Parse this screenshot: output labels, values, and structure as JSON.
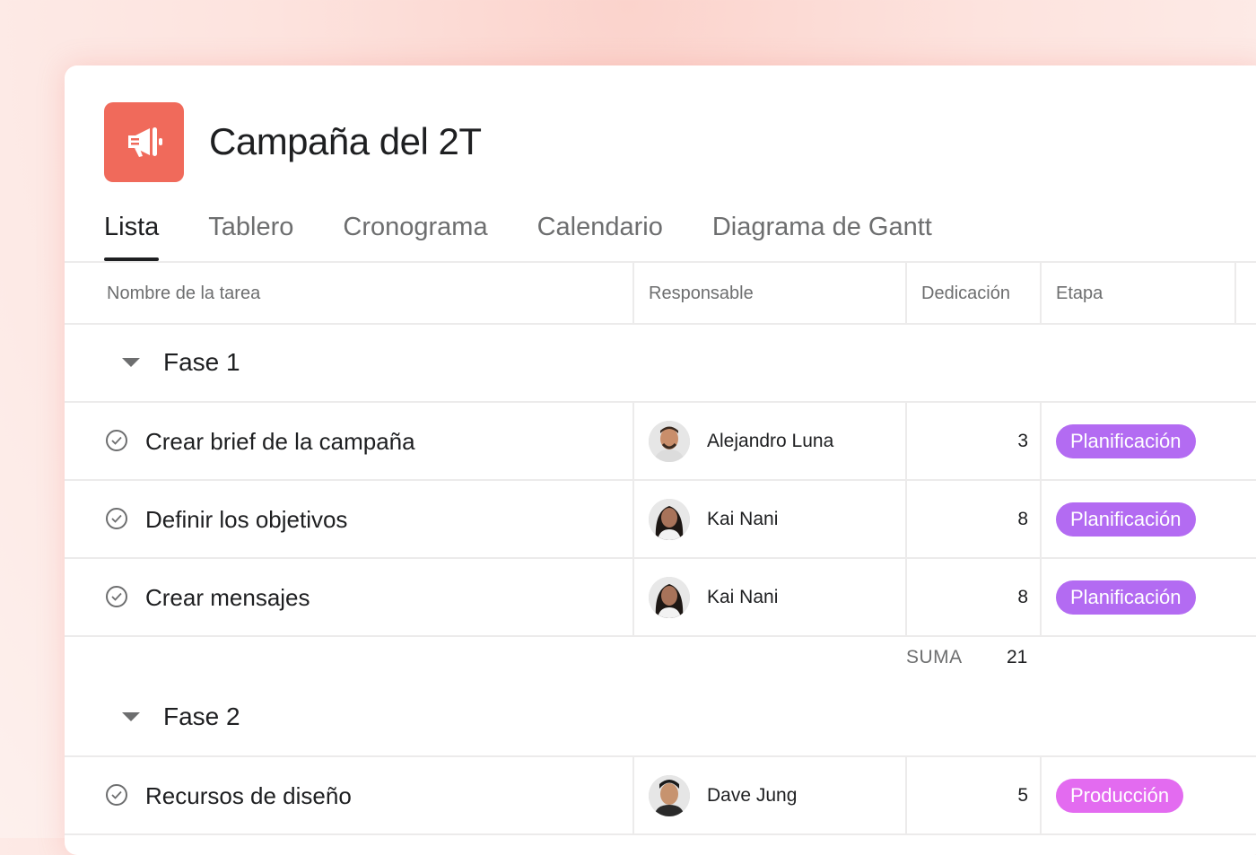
{
  "project": {
    "title": "Campaña del 2T",
    "icon": "megaphone-icon",
    "icon_color": "#f06a5b"
  },
  "tabs": [
    {
      "label": "Lista",
      "active": true
    },
    {
      "label": "Tablero"
    },
    {
      "label": "Cronograma"
    },
    {
      "label": "Calendario"
    },
    {
      "label": "Diagrama de Gantt"
    }
  ],
  "columns": {
    "task": "Nombre de la tarea",
    "assignee": "Responsable",
    "effort": "Dedicación",
    "stage": "Etapa"
  },
  "sections": [
    {
      "title": "Fase 1",
      "rows": [
        {
          "task": "Crear brief de la campaña",
          "assignee": "Alejandro Luna",
          "effort": "3",
          "stage": "Planificación"
        },
        {
          "task": "Definir los objetivos",
          "assignee": "Kai Nani",
          "effort": "8",
          "stage": "Planificación"
        },
        {
          "task": "Crear mensajes",
          "assignee": "Kai Nani",
          "effort": "8",
          "stage": "Planificación"
        }
      ],
      "sum_label": "SUMA",
      "sum_value": "21"
    },
    {
      "title": "Fase 2",
      "rows": [
        {
          "task": "Recursos de diseño",
          "assignee": "Dave Jung",
          "effort": "5",
          "stage": "Producción"
        }
      ]
    }
  ],
  "colors": {
    "planificacion": "#b36bf2",
    "produccion": "#e36bf0"
  }
}
